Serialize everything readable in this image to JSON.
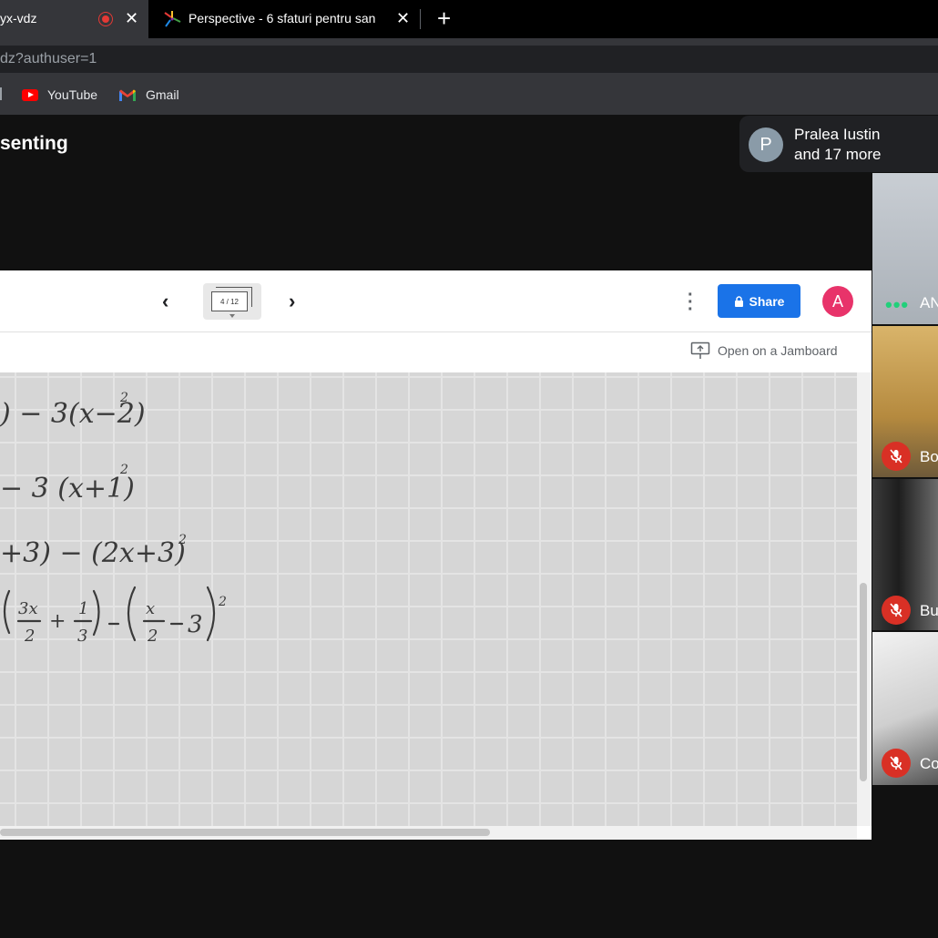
{
  "browser": {
    "tabs": [
      {
        "title": "yx-vdz",
        "active": true,
        "recording": true
      },
      {
        "title": "Perspective - 6 sfaturi pentru san",
        "active": false
      }
    ],
    "url": "dz?authuser=1",
    "bookmarks": [
      {
        "label": "YouTube",
        "icon": "youtube-icon"
      },
      {
        "label": "Gmail",
        "icon": "gmail-icon"
      }
    ]
  },
  "meet": {
    "presenting_label": "senting",
    "participants": {
      "avatar_letter": "P",
      "line1": "Pralea Iustin",
      "line2": "and 17 more"
    },
    "tiles": [
      {
        "name": "AN",
        "icon": "more-dots-icon",
        "bg": "#b9bec4"
      },
      {
        "name": "Bo",
        "icon": "mic-off-icon",
        "bg": "#c9a25b"
      },
      {
        "name": "Bu",
        "icon": "mic-off-icon",
        "bg": "#2a2a2a"
      },
      {
        "name": "Co",
        "icon": "mic-off-icon",
        "bg": "#e6e6e6"
      }
    ]
  },
  "jamboard": {
    "frame_indicator": "4 / 12",
    "share_label": "Share",
    "account_letter": "A",
    "open_label": "Open on a Jamboard",
    "equations": [
      {
        "text": ") − 3(x−2)",
        "sup": "2"
      },
      {
        "text": "− 3 (x+1)",
        "sup": "2"
      },
      {
        "text": "+3) − (2x+3)",
        "sup": "2"
      },
      {
        "text": "(3x/2 + 1/3) − (x/2 − 3)",
        "sup": "2"
      }
    ]
  },
  "colors": {
    "accent": "#1a73e8",
    "mic_off": "#d93025",
    "avatar_a": "#e8336a"
  }
}
